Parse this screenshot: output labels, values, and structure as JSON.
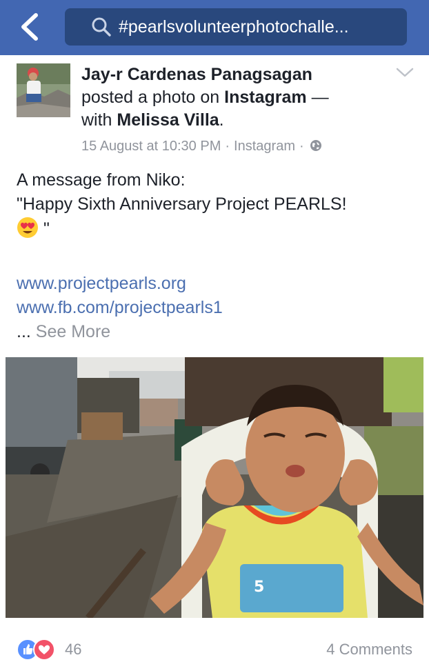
{
  "topbar": {
    "search_text": "#pearlsvolunteerphotochalle..."
  },
  "post": {
    "author": "Jay-r Cardenas Panagsagan",
    "action_prefix": "posted a photo on",
    "app_name": "Instagram",
    "action_suffix": "—",
    "with_prefix": "with",
    "with_name": "Melissa Villa",
    "with_suffix": ".",
    "timestamp": "15 August at 10:30 PM",
    "meta_sep": "·",
    "source": "Instagram",
    "body_line1": "A message from Niko:",
    "body_line2": "\"Happy Sixth Anniversary Project PEARLS!",
    "body_line3_suffix": "\"",
    "link1": "www.projectpearls.org",
    "link2": "www.fb.com/projectpearls1",
    "ellipsis": "...",
    "see_more": "See More"
  },
  "footer": {
    "reaction_count": "46",
    "comments": "4 Comments"
  },
  "icons": {
    "back": "chevron-left-icon",
    "search": "search-icon",
    "options": "chevron-down-icon",
    "privacy": "globe-icon",
    "like": "like-icon",
    "love": "love-icon",
    "emoji": "heart-eyes-emoji"
  },
  "colors": {
    "brand_blue": "#4267b2",
    "search_bg": "#29487d",
    "link": "#4b6fb0",
    "meta_gray": "#90949c",
    "like_blue": "#5890ff",
    "love_red": "#f25268"
  }
}
